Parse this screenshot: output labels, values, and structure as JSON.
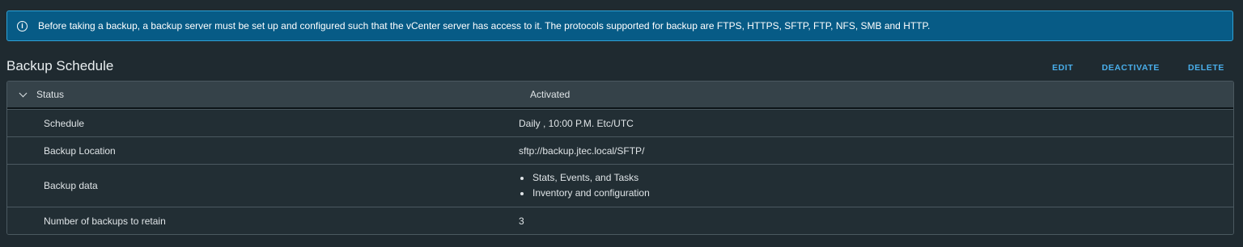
{
  "banner": {
    "icon": "info-icon",
    "text": "Before taking a backup, a backup server must be set up and configured such that the vCenter server has access to it. The protocols supported for backup are FTPS, HTTPS, SFTP, FTP, NFS, SMB and HTTP."
  },
  "section": {
    "title": "Backup Schedule"
  },
  "actions": {
    "edit": "EDIT",
    "deactivate": "DEACTIVATE",
    "delete": "DELETE"
  },
  "table": {
    "status": {
      "label": "Status",
      "value": "Activated"
    },
    "rows": [
      {
        "label": "Schedule",
        "value": "Daily , 10:00 P.M. Etc/UTC"
      },
      {
        "label": "Backup Location",
        "value": "sftp://backup.jtec.local/SFTP/"
      },
      {
        "label": "Backup data",
        "items": [
          "Stats, Events, and Tasks",
          "Inventory and configuration"
        ]
      },
      {
        "label": "Number of backups to retain",
        "value": "3"
      }
    ]
  },
  "colors": {
    "background": "#1f2a30",
    "banner": "#075b86",
    "banner_border": "#2fa1d6",
    "link": "#49aeea",
    "header_row": "#354249"
  }
}
